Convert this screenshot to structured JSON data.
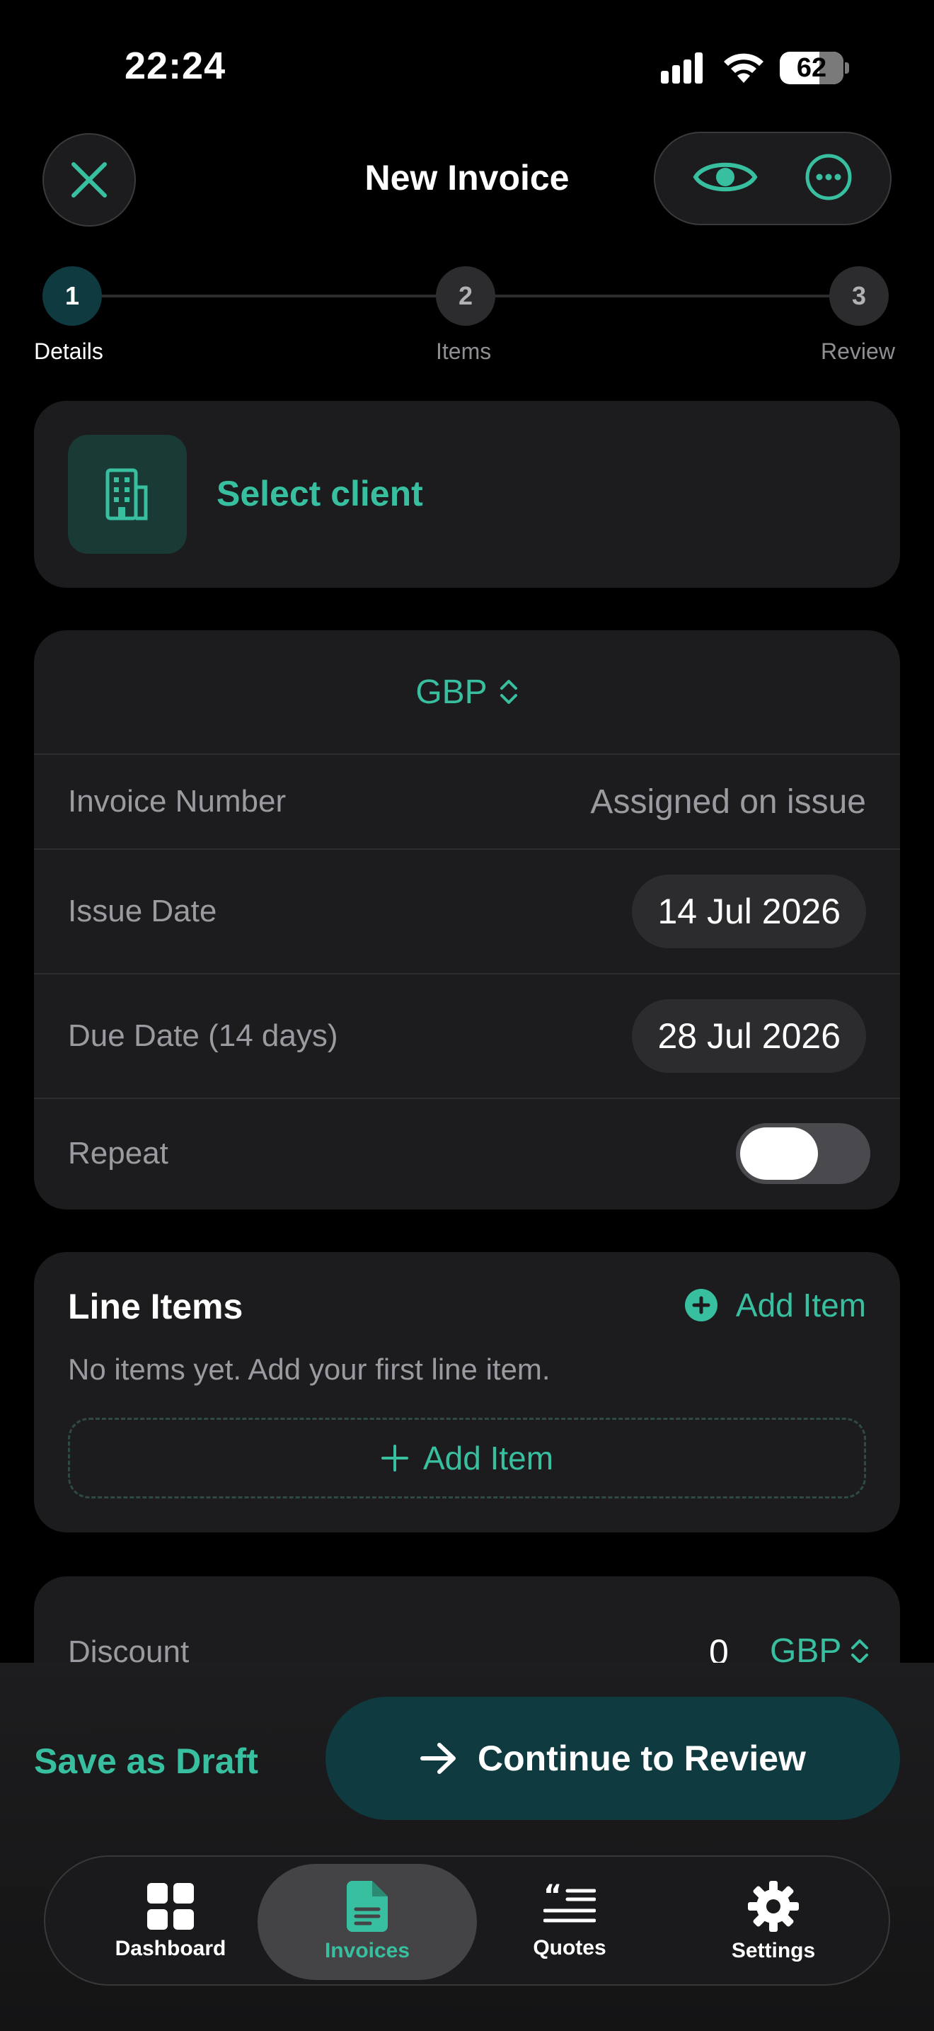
{
  "status_bar": {
    "time": "22:24",
    "battery": "62"
  },
  "header": {
    "title": "New Invoice"
  },
  "stepper": {
    "steps": [
      {
        "number": "1",
        "label": "Details"
      },
      {
        "number": "2",
        "label": "Items"
      },
      {
        "number": "3",
        "label": "Review"
      }
    ],
    "current": 1
  },
  "client": {
    "label": "Select client"
  },
  "details": {
    "currency": "GBP",
    "invoice_number_label": "Invoice Number",
    "invoice_number_value": "Assigned on issue",
    "issue_date_label": "Issue Date",
    "issue_date_value": "14 Jul 2026",
    "due_date_label": "Due Date (14 days)",
    "due_date_value": "28 Jul 2026",
    "repeat_label": "Repeat",
    "repeat_on": false
  },
  "line_items": {
    "title": "Line Items",
    "add_label": "Add Item",
    "empty_text": "No items yet. Add your first line item.",
    "add_button_label": "Add Item"
  },
  "discount": {
    "label": "Discount",
    "value": "0",
    "currency": "GBP"
  },
  "actions": {
    "draft_label": "Save as Draft",
    "continue_label": "Continue to Review"
  },
  "tabs": [
    {
      "label": "Dashboard",
      "icon": "grid-icon"
    },
    {
      "label": "Invoices",
      "icon": "document-icon",
      "active": true
    },
    {
      "label": "Quotes",
      "icon": "quote-icon"
    },
    {
      "label": "Settings",
      "icon": "gear-icon"
    }
  ],
  "colors": {
    "accent": "#38bfa0",
    "accent_dark": "#0f3a40",
    "card": "#1c1c1e",
    "background": "#000000"
  }
}
